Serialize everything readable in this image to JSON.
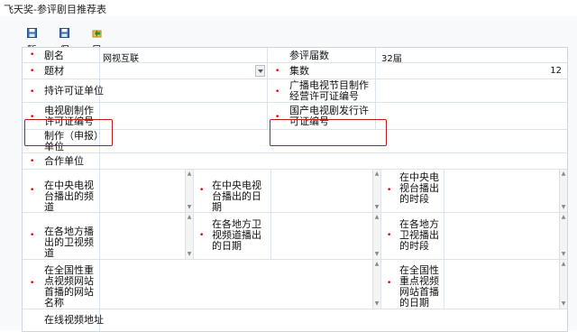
{
  "window": {
    "title": "飞天奖-参评剧目推荐表"
  },
  "toolbar": {
    "save_draft": "暂存",
    "save": "保存",
    "export": "导出"
  },
  "colors": {
    "required": "#d40000",
    "highlight": "#c0161e"
  },
  "form": {
    "title_label": "剧名",
    "title_value": "网视互联",
    "edition_label": "参评届数",
    "edition_value": "32届",
    "genre_label": "题材",
    "genre_value": "",
    "episodes_label": "集数",
    "episodes_value": "12",
    "licensee_label": "持许可证单位",
    "broadcast_license_label": "广播电视节目制作经营许可证编号",
    "production_license_label": "电视剧制作许可证编号",
    "distribution_license_label": "国产电视剧发行许可证编号",
    "producer_label": "制作（申报）单位",
    "partner_label": "合作单位",
    "cctv_channel_label": "在中央电视台播出的频道",
    "cctv_date_label": "在中央电视台播出的日期",
    "cctv_slot_label": "在中央电视台播出的时段",
    "local_channel_label": "在各地方播出的卫视频道",
    "local_date_label": "在各地方卫视频道播出的日期",
    "local_slot_label": "在各地方卫视播出的时段",
    "web_name_label": "在全国性重点视频网站首播的网站名称",
    "web_date_label": "在全国性重点视频网站首播的日期",
    "online_url_label": "在线视频地址"
  }
}
